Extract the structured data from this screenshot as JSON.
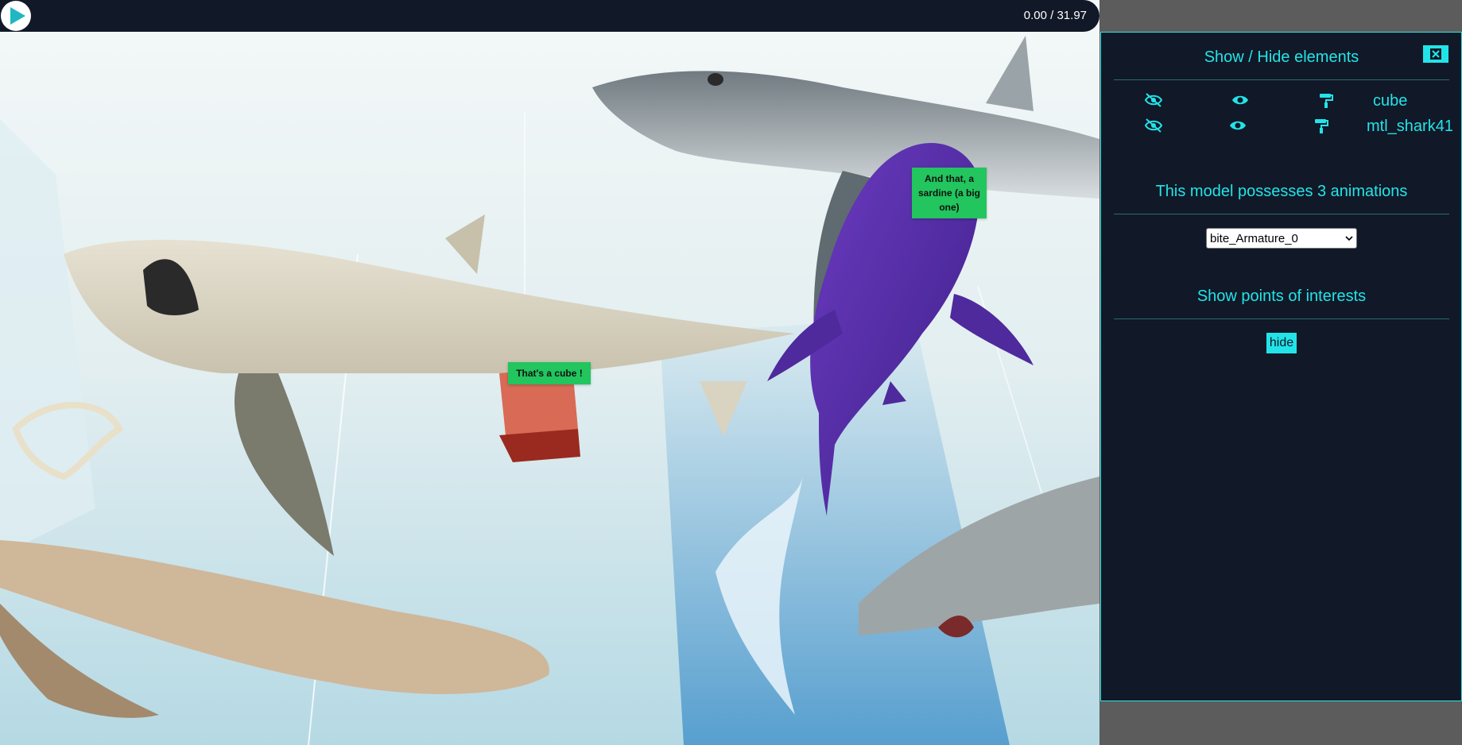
{
  "player": {
    "time_readout": "0.00 / 31.97"
  },
  "poi_labels": {
    "cube": "That's a cube !",
    "shark": "And that, a sardine (a big one)"
  },
  "panel": {
    "elements_title": "Show / Hide elements",
    "elements": [
      {
        "name": "cube"
      },
      {
        "name": "mtl_shark41"
      }
    ],
    "animations_title": "This model possesses 3 animations",
    "animation_selected": "bite_Armature_0",
    "poi_title": "Show points of interests",
    "poi_toggle_label": "hide"
  },
  "colors": {
    "accent": "#22e4e8",
    "panel_bg": "#111827",
    "poi_bg": "#22c55e",
    "cube": "#c94a35",
    "shark": "#5b2ea6"
  },
  "icons": {
    "play": "play-icon",
    "close": "close-icon",
    "hide": "eye-slash-icon",
    "show": "eye-icon",
    "paint": "paint-roller-icon",
    "dropdown": "chevron-down-icon"
  }
}
